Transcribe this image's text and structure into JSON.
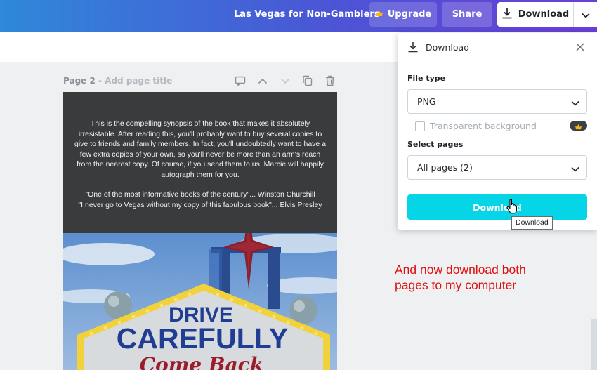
{
  "header": {
    "doc_title": "Las Vegas for Non-Gamblers",
    "upgrade_label": "Upgrade",
    "share_label": "Share",
    "download_label": "Download"
  },
  "page": {
    "label": "Page 2",
    "separator": " - ",
    "title_placeholder": "Add page title",
    "synopsis": "This is the compelling synopsis of the book that makes it absolutely irresistable. After reading this, you'll probably want to buy several copies to give to friends and family members. In fact, you'll undoubtedly want to have a few extra copies of your own, so you'll never be more than an arm's reach from the nearest copy. Of course, if you send them to us, Marcie will happily autograph  them for you.",
    "quote1": "\"One of the most informative books of the century\"... Winston Churchill",
    "quote2": "\"I never go to Vegas without my copy of this fabulous book\"... Elvis Presley",
    "sign_line1": "DRIVE",
    "sign_line2": "CAREFULLY",
    "sign_line3": "Come Back"
  },
  "download_panel": {
    "title": "Download",
    "file_type_label": "File type",
    "file_type_value": "PNG",
    "transparent_label": "Transparent background",
    "transparent_checked": false,
    "select_pages_label": "Select pages",
    "select_pages_value": "All pages (2)",
    "download_button_label": "Download",
    "tooltip": "Download"
  },
  "annotation": {
    "line1": "And now download both",
    "line2": "pages to my computer"
  },
  "colors": {
    "accent": "#05d5e7",
    "header_start": "#2f88d9",
    "header_end": "#6a3fd6",
    "annotation": "#e01010",
    "crown": "#f5b814"
  },
  "icons": [
    "crown-icon",
    "download-icon",
    "chevron-down-icon",
    "close-icon",
    "comment-icon",
    "arrow-up-icon",
    "arrow-down-icon",
    "duplicate-icon",
    "trash-icon",
    "hand-cursor-icon"
  ]
}
